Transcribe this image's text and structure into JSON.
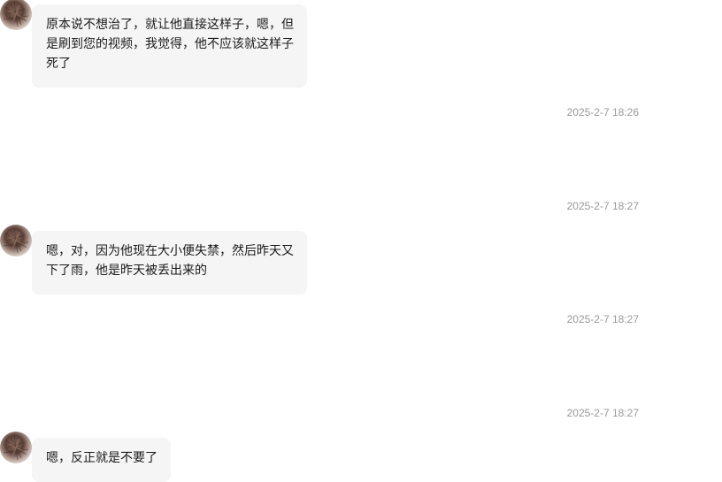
{
  "messages": [
    {
      "type": "incoming",
      "text": "原本说不想治了，就让他直接这样子，嗯，但是刷到您的视频，我觉得，他不应该就这样子死了"
    },
    {
      "type": "timestamp",
      "text": "2025-2-7 18:26"
    },
    {
      "type": "timestamp",
      "text": "2025-2-7 18:27"
    },
    {
      "type": "incoming",
      "text": "嗯，对，因为他现在大小便失禁，然后昨天又下了雨，他是昨天被丢出来的"
    },
    {
      "type": "timestamp",
      "text": "2025-2-7 18:27"
    },
    {
      "type": "timestamp",
      "text": "2025-2-7 18:27"
    },
    {
      "type": "incoming",
      "text": "嗯，反正就是不要了"
    }
  ],
  "colors": {
    "bubble_bg": "#f5f5f5",
    "timestamp_text": "#999999",
    "message_text": "#1a1a1a"
  },
  "icons": {
    "avatar": "user-avatar-icon"
  }
}
